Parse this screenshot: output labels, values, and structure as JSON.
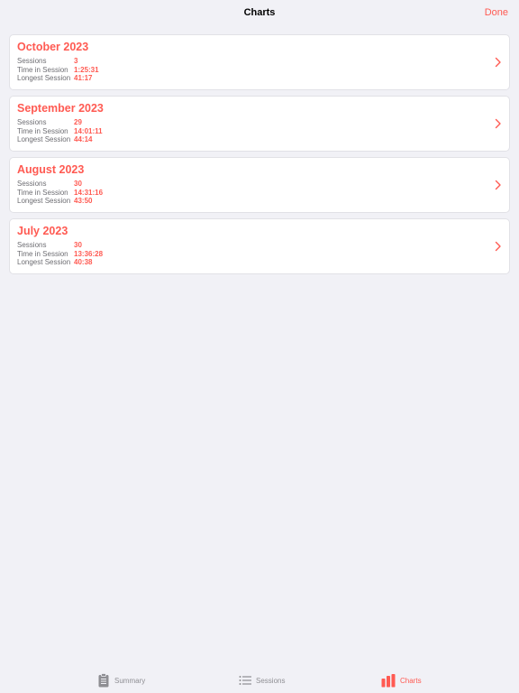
{
  "navbar": {
    "title": "Charts",
    "done_label": "Done"
  },
  "months": [
    {
      "title": "October 2023",
      "stats": [
        {
          "label": "Sessions",
          "value": "3"
        },
        {
          "label": "Time in Session",
          "value": "1:25:31"
        },
        {
          "label": "Longest Session",
          "value": "41:17"
        }
      ]
    },
    {
      "title": "September 2023",
      "stats": [
        {
          "label": "Sessions",
          "value": "29"
        },
        {
          "label": "Time in Session",
          "value": "14:01:11"
        },
        {
          "label": "Longest Session",
          "value": "44:14"
        }
      ]
    },
    {
      "title": "August 2023",
      "stats": [
        {
          "label": "Sessions",
          "value": "30"
        },
        {
          "label": "Time in Session",
          "value": "14:31:16"
        },
        {
          "label": "Longest Session",
          "value": "43:50"
        }
      ]
    },
    {
      "title": "July 2023",
      "stats": [
        {
          "label": "Sessions",
          "value": "30"
        },
        {
          "label": "Time in Session",
          "value": "13:36:28"
        },
        {
          "label": "Longest Session",
          "value": "40:38"
        }
      ]
    }
  ],
  "tabbar": {
    "summary_label": "Summary",
    "sessions_label": "Sessions",
    "charts_label": "Charts",
    "active_tab": "Charts",
    "icons": {
      "summary": "clipboard-icon",
      "sessions": "list-icon",
      "charts": "bar-chart-icon"
    }
  },
  "colors": {
    "accent": "#ff5a52",
    "background": "#f1f1f6",
    "card": "#ffffff",
    "secondary_text": "#6d6d72",
    "inactive_tab": "#8e8e93"
  }
}
